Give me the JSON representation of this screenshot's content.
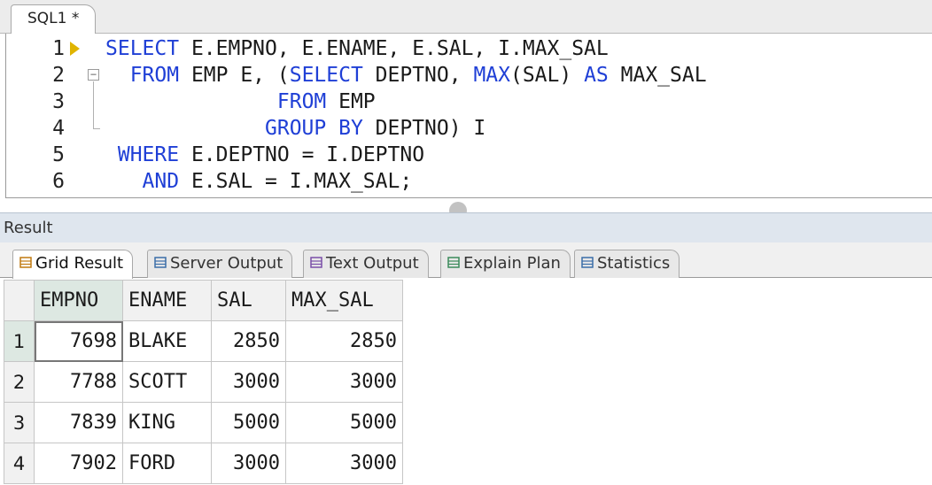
{
  "editor": {
    "tab_label": "SQL1 *",
    "lines": [
      {
        "num": "1",
        "indent": "",
        "tokens": [
          {
            "t": "SELECT",
            "k": "kw"
          },
          {
            "t": " E.EMPNO, E.ENAME, E.SAL, I.MAX_SAL",
            "k": ""
          }
        ]
      },
      {
        "num": "2",
        "indent": "  ",
        "tokens": [
          {
            "t": "FROM",
            "k": "kw"
          },
          {
            "t": " EMP E, (",
            "k": ""
          },
          {
            "t": "SELECT",
            "k": "kw"
          },
          {
            "t": " DEPTNO, ",
            "k": ""
          },
          {
            "t": "MAX",
            "k": "fn"
          },
          {
            "t": "(SAL) ",
            "k": ""
          },
          {
            "t": "AS",
            "k": "kw"
          },
          {
            "t": " MAX_SAL",
            "k": ""
          }
        ]
      },
      {
        "num": "3",
        "indent": "              ",
        "tokens": [
          {
            "t": "FROM",
            "k": "kw"
          },
          {
            "t": " EMP",
            "k": ""
          }
        ]
      },
      {
        "num": "4",
        "indent": "             ",
        "tokens": [
          {
            "t": "GROUP BY",
            "k": "kw"
          },
          {
            "t": " DEPTNO) I",
            "k": ""
          }
        ]
      },
      {
        "num": "5",
        "indent": " ",
        "tokens": [
          {
            "t": "WHERE",
            "k": "kw"
          },
          {
            "t": " E.DEPTNO = I.DEPTNO",
            "k": ""
          }
        ]
      },
      {
        "num": "6",
        "indent": "   ",
        "tokens": [
          {
            "t": "AND",
            "k": "kw"
          },
          {
            "t": " E.SAL = I.MAX_SAL;",
            "k": ""
          }
        ]
      }
    ]
  },
  "result": {
    "title": "Result",
    "tabs": [
      {
        "label": "Grid Result",
        "icon": "grid-icon",
        "active": true
      },
      {
        "label": "Server Output",
        "icon": "server-output-icon",
        "active": false
      },
      {
        "label": "Text Output",
        "icon": "text-output-icon",
        "active": false
      },
      {
        "label": "Explain Plan",
        "icon": "explain-plan-icon",
        "active": false
      },
      {
        "label": "Statistics",
        "icon": "statistics-icon",
        "active": false
      }
    ],
    "columns": [
      "EMPNO",
      "ENAME",
      "SAL",
      "MAX_SAL"
    ],
    "rows": [
      {
        "n": "1",
        "cells": [
          "7698",
          "BLAKE",
          "2850",
          "2850"
        ]
      },
      {
        "n": "2",
        "cells": [
          "7788",
          "SCOTT",
          "3000",
          "3000"
        ]
      },
      {
        "n": "3",
        "cells": [
          "7839",
          "KING",
          "5000",
          "5000"
        ]
      },
      {
        "n": "4",
        "cells": [
          "7902",
          "FORD",
          "3000",
          "3000"
        ]
      }
    ]
  },
  "colors": {
    "keyword": "#1f3fd6",
    "selected_header": "#dde8e2",
    "exec_marker": "#e0b400"
  }
}
